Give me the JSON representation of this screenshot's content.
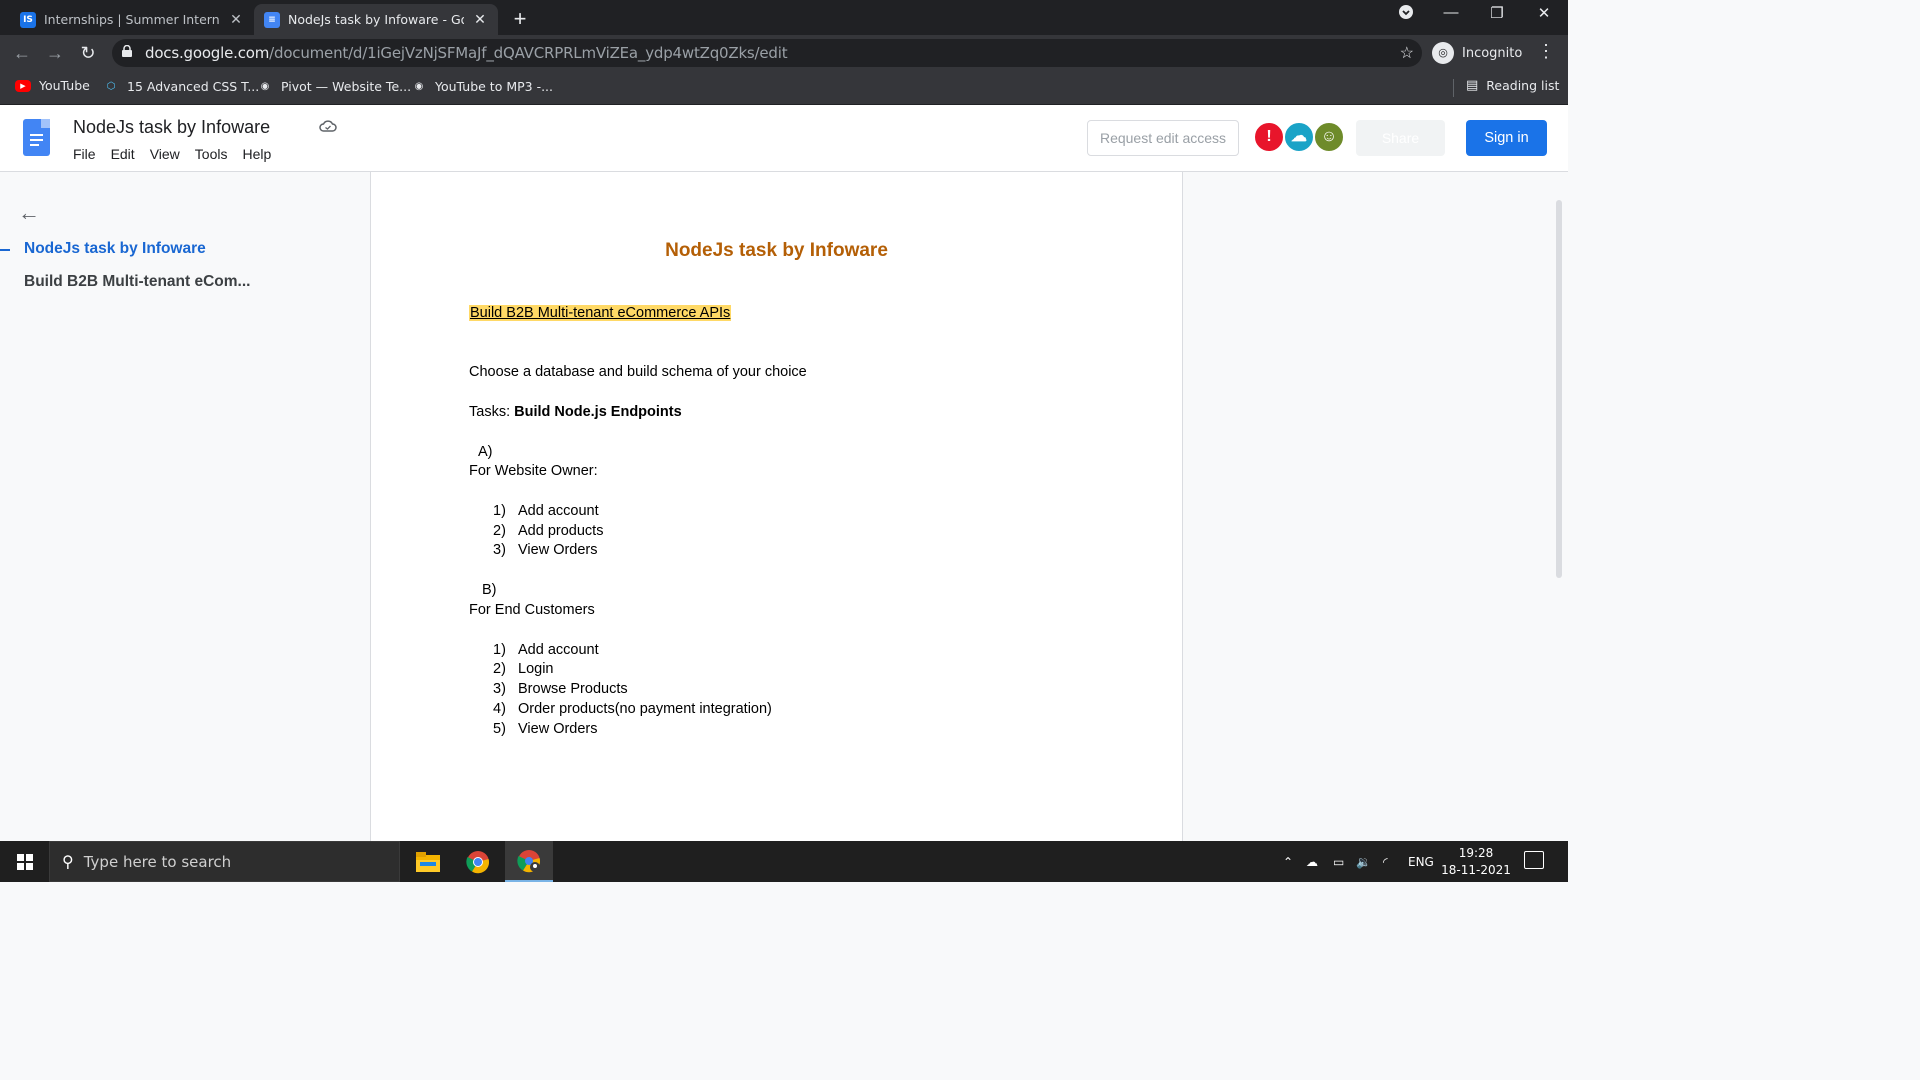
{
  "browser": {
    "tabs": [
      {
        "title": "Internships | Summer Internship",
        "favicon": "IS",
        "favicon_color": "#1a73e8"
      },
      {
        "title": "NodeJs task by Infoware - Googl",
        "favicon": "docs",
        "favicon_color": "#4285f4"
      }
    ],
    "url_host": "docs.google.com",
    "url_path": "/document/d/1iGejVzNjSFMaJf_dQAVCRPRLmViZEa_ydp4wtZq0Zks/edit",
    "profile_label": "Incognito",
    "bookmarks": [
      "YouTube",
      "15 Advanced CSS T...",
      "Pivot — Website Te...",
      "YouTube to MP3 -..."
    ],
    "reading_list": "Reading list"
  },
  "docs": {
    "title": "NodeJs task by Infoware",
    "menu": [
      "File",
      "Edit",
      "View",
      "Tools",
      "Help"
    ],
    "request_edit": "Request edit access",
    "share": "Share",
    "sign_in": "Sign in",
    "avatar_colors": [
      "#e8152b",
      "#1aa3c7",
      "#6e8b2a"
    ]
  },
  "outline": {
    "items": [
      "NodeJs task by Infoware",
      "Build B2B Multi-tenant eCom..."
    ]
  },
  "document": {
    "heading": "NodeJs task by Infoware",
    "subheading": "Build B2B Multi-tenant eCommerce APIs",
    "intro": "Choose a database and build schema of your choice",
    "tasks_prefix": "Tasks: ",
    "tasks_bold": "Build Node.js Endpoints",
    "section_a_label": "A)",
    "section_a_title": "For Website Owner:",
    "section_a_items": [
      "Add account",
      "Add products",
      "View Orders"
    ],
    "section_b_label": "B)",
    "section_b_title": "For End Customers",
    "section_b_items": [
      "Add account",
      "Login",
      "Browse Products",
      "Order products(no payment integration)",
      "View Orders"
    ]
  },
  "taskbar": {
    "search_placeholder": "Type here to search",
    "language": "ENG",
    "time": "19:28",
    "date": "18-11-2021"
  }
}
